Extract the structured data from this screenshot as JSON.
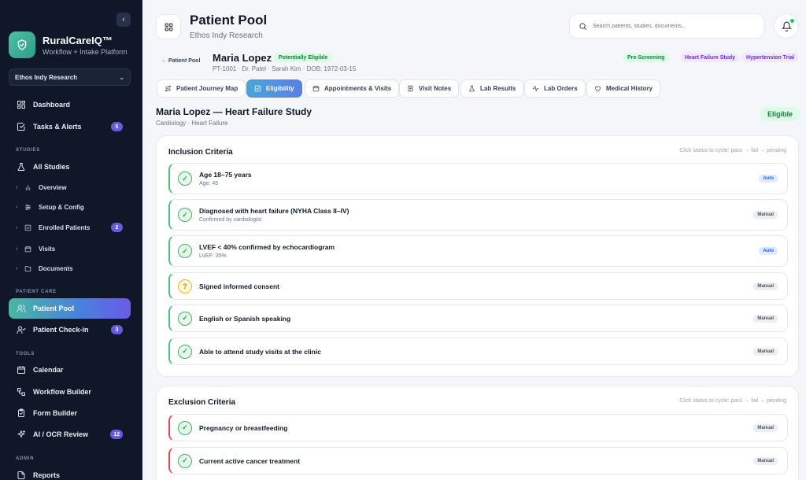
{
  "sidebar": {
    "brand_name": "RuralCareIQ™",
    "brand_sub": "Workflow + Intake Platform",
    "org": "Ethos Indy Research",
    "items": [
      {
        "label": "Dashboard",
        "icon": "grid-icon"
      },
      {
        "label": "Tasks & Alerts",
        "icon": "check-square-icon",
        "badge": "5"
      },
      {
        "label": "All Studies",
        "icon": "flask-icon"
      },
      {
        "label": "Patient Pool",
        "icon": "users-icon",
        "active": true
      },
      {
        "label": "Patient Check-in",
        "icon": "user-check-icon",
        "badge": "3"
      },
      {
        "label": "Calendar",
        "icon": "calendar-icon"
      },
      {
        "label": "Workflow Builder",
        "icon": "workflow-icon"
      },
      {
        "label": "Form Builder",
        "icon": "clipboard-icon"
      },
      {
        "label": "AI / OCR Review",
        "icon": "sparkle-icon",
        "badge": "12"
      },
      {
        "label": "Reports",
        "icon": "file-icon"
      }
    ],
    "sections": {
      "studies": "STUDIES",
      "patient_care": "PATIENT CARE",
      "tools": "TOOLS",
      "admin": "ADMIN"
    },
    "study_sub": [
      {
        "label": "Overview",
        "icon": "bar-chart-icon"
      },
      {
        "label": "Setup & Config",
        "icon": "sliders-icon"
      },
      {
        "label": "Enrolled Patients",
        "icon": "check-box-icon",
        "badge": "2"
      },
      {
        "label": "Visits",
        "icon": "calendar-icon"
      },
      {
        "label": "Documents",
        "icon": "folder-icon"
      }
    ]
  },
  "header": {
    "title": "Patient Pool",
    "subtitle": "Ethos Indy Research",
    "search_placeholder": "Search patients, studies, documents..."
  },
  "patient": {
    "back": "Patient Pool",
    "name": "Maria Lopez",
    "status": "Potentially Eligible",
    "meta": "PT-1001 · Dr. Patel · Sarah Kim · DOB: 1972-03-15",
    "tags": [
      "Pre-Screening",
      "Heart Failure Study",
      "Hypertension Trial"
    ]
  },
  "tabs": [
    "Patient Journey Map",
    "Eligibility",
    "Appointments & Visits",
    "Visit Notes",
    "Lab Results",
    "Lab Orders",
    "Medical History"
  ],
  "study": {
    "title": "Maria Lopez — Heart Failure Study",
    "subtitle": "Cardiology · Heart Failure",
    "result": "Eligible"
  },
  "inclusion": {
    "title": "Inclusion Criteria",
    "hint": "Click status to cycle: pass → fail → pending",
    "items": [
      {
        "label": "Age 18–75 years",
        "note": "Age: 45",
        "status": "pass",
        "mode": "Auto"
      },
      {
        "label": "Diagnosed with heart failure (NYHA Class II–IV)",
        "note": "Confirmed by cardiologist",
        "status": "pass",
        "mode": "Manual"
      },
      {
        "label": "LVEF < 40% confirmed by echocardiogram",
        "note": "LVEF: 35%",
        "status": "pass",
        "mode": "Auto"
      },
      {
        "label": "Signed informed consent",
        "note": "",
        "status": "pending",
        "mode": "Manual"
      },
      {
        "label": "English or Spanish speaking",
        "note": "",
        "status": "pass",
        "mode": "Manual"
      },
      {
        "label": "Able to attend study visits at the clinic",
        "note": "",
        "status": "pass",
        "mode": "Manual"
      }
    ]
  },
  "exclusion": {
    "title": "Exclusion Criteria",
    "hint": "Click status to cycle: pass → fail → pending",
    "items": [
      {
        "label": "Pregnancy or breastfeeding",
        "note": "",
        "status": "pass",
        "mode": "Manual"
      },
      {
        "label": "Current active cancer treatment",
        "note": "",
        "status": "pass",
        "mode": "Manual"
      }
    ]
  },
  "glyphs": {
    "pass": "✓",
    "pending": "?",
    "back_arrow": "←",
    "chevron": "⌄",
    "collapse": "‹",
    "sub_arrow": "›"
  }
}
